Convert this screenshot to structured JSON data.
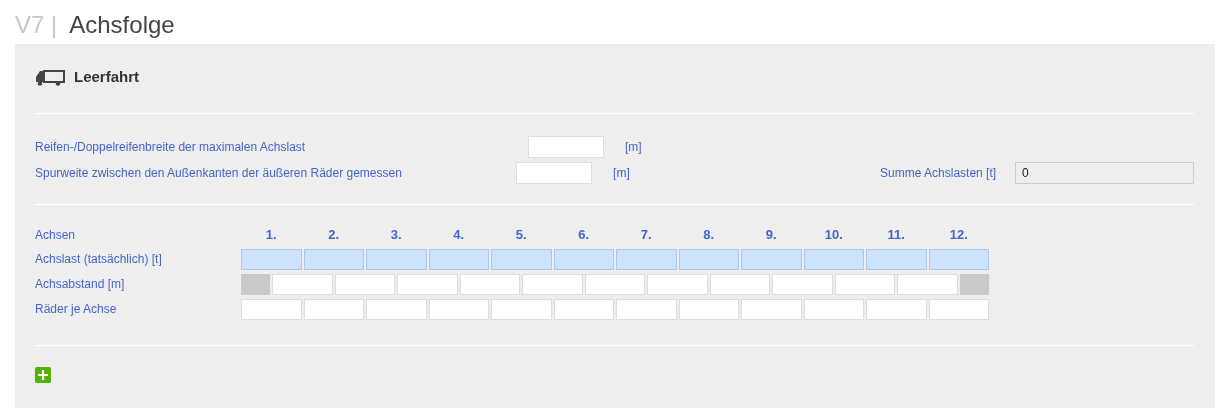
{
  "header": {
    "prefix": "V7 |",
    "title": "Achsfolge"
  },
  "section": {
    "title": "Leerfahrt"
  },
  "fields": [
    {
      "label": "Reifen-/Doppelreifenbreite der maximalen Achslast",
      "unit": "[m]"
    },
    {
      "label": "Spurweite zwischen den Außenkanten der äußeren Räder gemessen",
      "unit": "[m]"
    }
  ],
  "sum": {
    "label": "Summe Achslasten [t]",
    "value": "0"
  },
  "axles": {
    "label": "Achsen",
    "numbers": [
      "1.",
      "2.",
      "3.",
      "4.",
      "5.",
      "6.",
      "7.",
      "8.",
      "9.",
      "10.",
      "11.",
      "12."
    ]
  },
  "rows": [
    {
      "label": "Achslast (tatsächlich) [t]",
      "kind": "load",
      "cells": [
        {
          "disabled": false
        },
        {
          "disabled": false
        },
        {
          "disabled": false
        },
        {
          "disabled": false
        },
        {
          "disabled": false
        },
        {
          "disabled": false
        },
        {
          "disabled": false
        },
        {
          "disabled": false
        },
        {
          "disabled": false
        },
        {
          "disabled": false
        },
        {
          "disabled": false
        },
        {
          "disabled": false
        }
      ]
    },
    {
      "label": "Achsabstand [m]",
      "kind": "spacing",
      "cells": [
        {
          "disabled": true
        },
        {
          "disabled": false
        },
        {
          "disabled": false
        },
        {
          "disabled": false
        },
        {
          "disabled": false
        },
        {
          "disabled": false
        },
        {
          "disabled": false
        },
        {
          "disabled": false
        },
        {
          "disabled": false
        },
        {
          "disabled": false
        },
        {
          "disabled": false
        },
        {
          "disabled": false
        },
        {
          "disabled": true
        }
      ]
    },
    {
      "label": "Räder je Achse",
      "kind": "wheels",
      "cells": [
        {
          "disabled": false
        },
        {
          "disabled": false
        },
        {
          "disabled": false
        },
        {
          "disabled": false
        },
        {
          "disabled": false
        },
        {
          "disabled": false
        },
        {
          "disabled": false
        },
        {
          "disabled": false
        },
        {
          "disabled": false
        },
        {
          "disabled": false
        },
        {
          "disabled": false
        },
        {
          "disabled": false
        }
      ]
    }
  ]
}
